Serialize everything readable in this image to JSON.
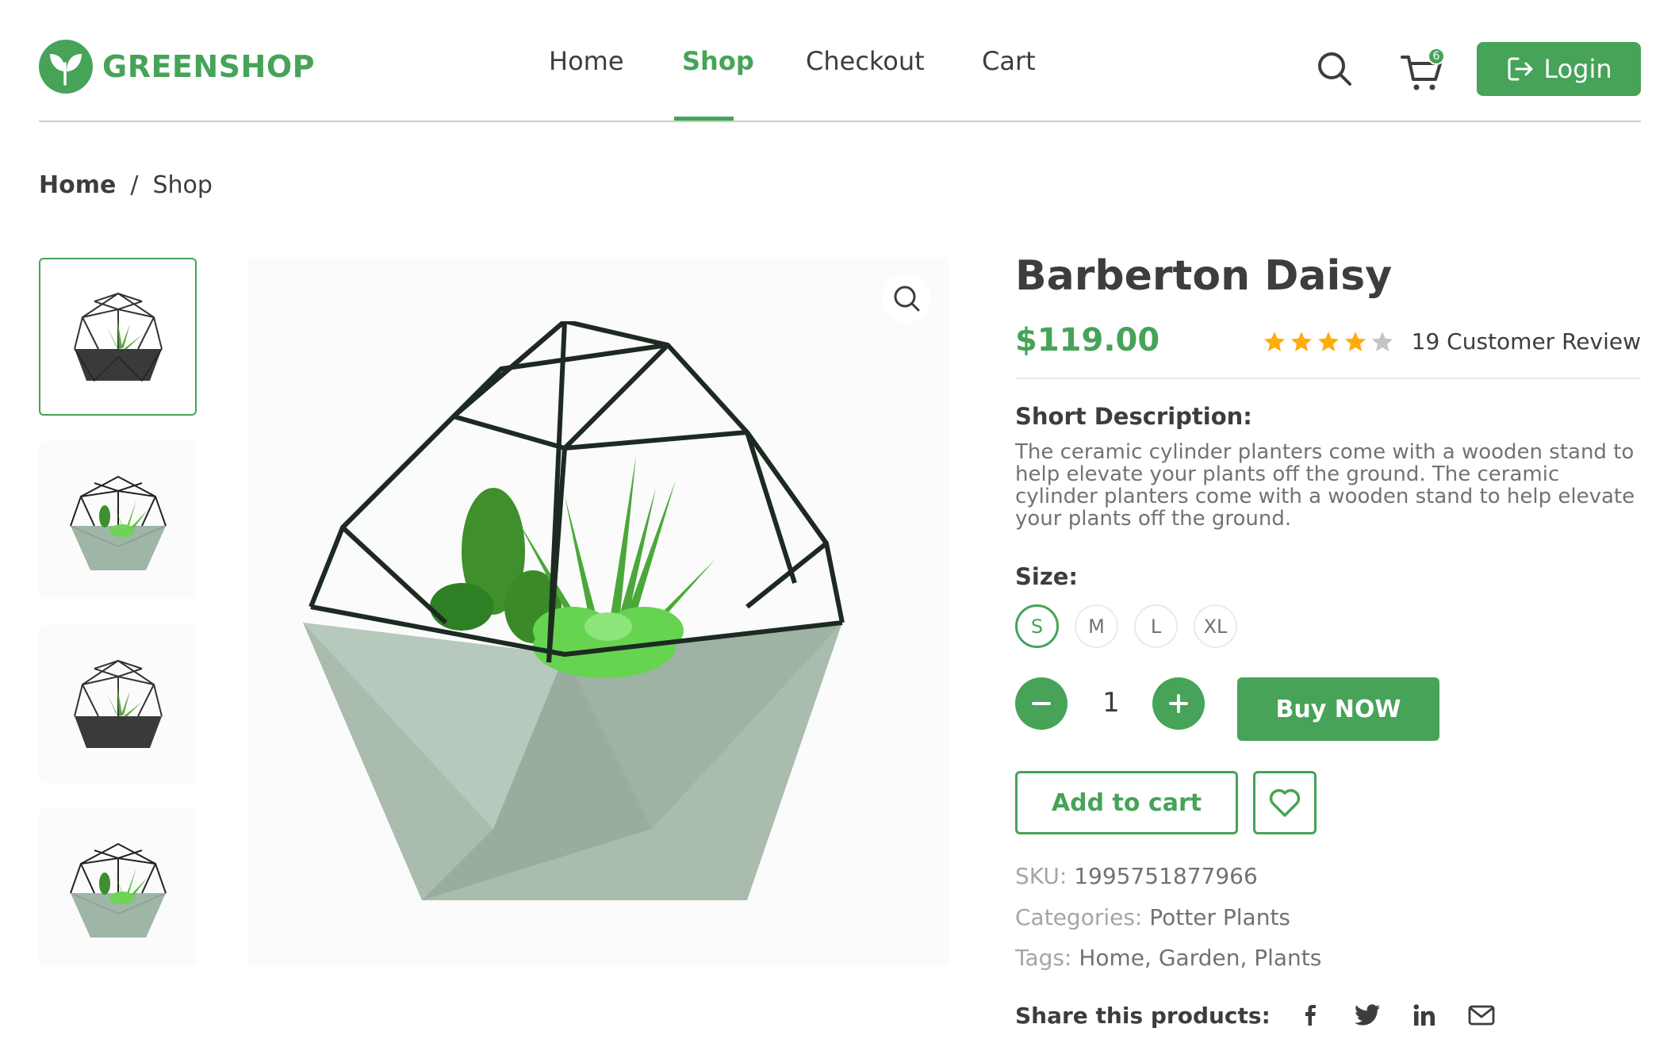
{
  "brand": {
    "name": "GREENSHOP"
  },
  "nav": {
    "home": "Home",
    "shop": "Shop",
    "checkout": "Checkout",
    "cart": "Cart"
  },
  "header": {
    "cart_count": "6",
    "login_label": "Login"
  },
  "breadcrumb": {
    "home": "Home",
    "separator": "/",
    "current": "Shop"
  },
  "product": {
    "title": "Barberton Daisy",
    "price": "$119.00",
    "rating": 4,
    "rating_max": 5,
    "review_text": "19 Customer Review",
    "short_description_label": "Short Description:",
    "short_description": "The ceramic cylinder planters come with a wooden stand to help elevate your plants off the ground. The ceramic cylinder planters come with a wooden stand to help elevate your plants off the ground.",
    "size_label": "Size:",
    "sizes": [
      "S",
      "M",
      "L",
      "XL"
    ],
    "selected_size": "S",
    "quantity": "1",
    "buy_now_label": "Buy NOW",
    "add_to_cart_label": "Add to cart",
    "sku_label": "SKU:",
    "sku": "1995751877966",
    "categories_label": "Categories:",
    "categories": "Potter Plants",
    "tags_label": "Tags:",
    "tags": "Home, Garden, Plants",
    "share_label": "Share this products:"
  },
  "colors": {
    "accent": "#46A358",
    "text": "#3D3D3D",
    "muted": "#727272",
    "star_filled": "#FFAC0C",
    "star_empty": "#C4C4C4"
  },
  "icons": {
    "search": "search-icon",
    "cart": "cart-icon",
    "login": "logout-icon",
    "zoom": "zoom-icon",
    "wishlist": "heart-icon",
    "share": [
      "facebook-icon",
      "twitter-icon",
      "linkedin-icon",
      "mail-icon"
    ]
  }
}
